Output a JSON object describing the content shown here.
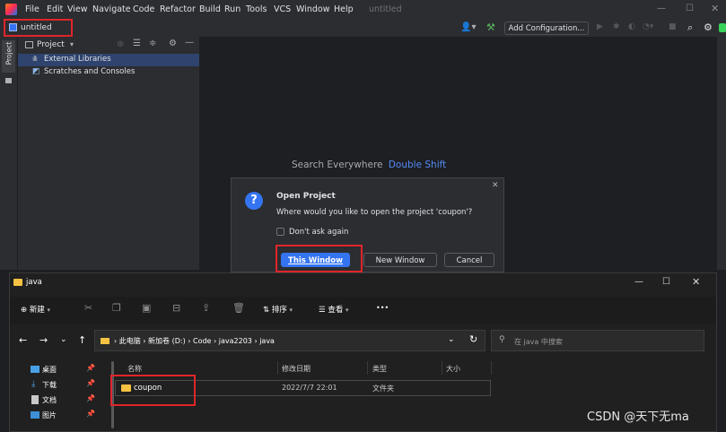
{
  "ide": {
    "app_title": "untitled",
    "menu": [
      "File",
      "Edit",
      "View",
      "Navigate",
      "Code",
      "Refactor",
      "Build",
      "Run",
      "Tools",
      "VCS",
      "Window",
      "Help"
    ],
    "breadcrumb": "untitled",
    "add_config_label": "Add Configuration...",
    "project_dropdown": "Project",
    "strip_label": "Project",
    "tree": [
      "External Libraries",
      "Scratches and Consoles"
    ],
    "search_hint": "Search Everywhere",
    "search_shortcut": "Double Shift"
  },
  "dialog": {
    "title": "Open Project",
    "message": "Where would you like to open the project 'coupon'?",
    "checkbox_label": "Don't ask again",
    "this_window": "This Window",
    "new_window": "New Window",
    "cancel": "Cancel"
  },
  "explorer": {
    "title": "java",
    "new_label": "新建",
    "sort_label": "排序",
    "view_label": "查看",
    "more_label": "•••",
    "path": [
      "此电脑",
      "新加卷 (D:)",
      "Code",
      "java2203",
      "java"
    ],
    "search_placeholder": "在 java 中搜索",
    "quick_access": [
      "桌面",
      "下载",
      "文档",
      "图片"
    ],
    "columns": [
      "名称",
      "修改日期",
      "类型",
      "大小"
    ],
    "rows": [
      {
        "name": "coupon",
        "date": "2022/7/7 22:01",
        "type": "文件夹",
        "size": ""
      }
    ]
  },
  "watermark": "CSDN @天下无ma",
  "colors": {
    "highlight": "#e0252a",
    "accent": "#3574f0",
    "link": "#548af7",
    "folder": "#f5c242"
  }
}
